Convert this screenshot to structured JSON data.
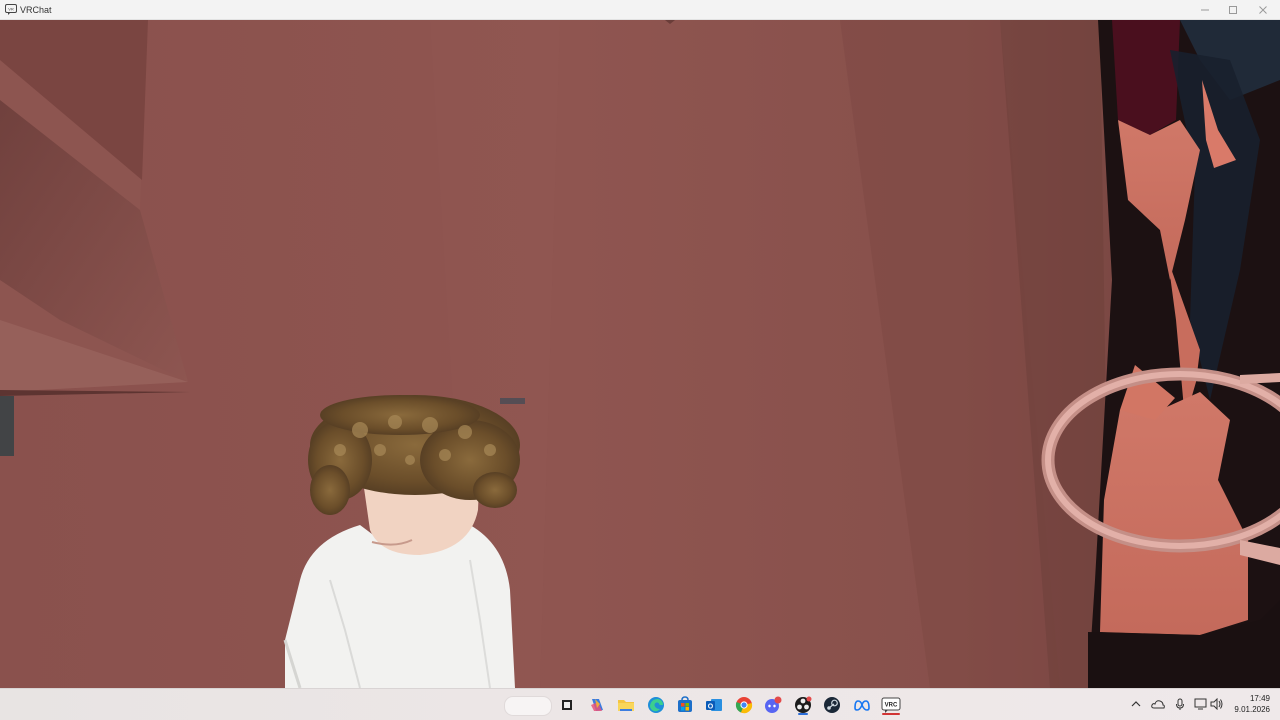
{
  "window": {
    "title": "VRChat",
    "icon": "vrchat-app-icon",
    "controls": [
      "minimize-icon",
      "maximize-icon",
      "close-icon"
    ]
  },
  "scene": {
    "description_colors": {
      "wall": "#8c524e",
      "wall_light": "#945a55",
      "wall_dark": "#6e3e3b",
      "skin": "#c97060",
      "dark": "#1a0f10",
      "hoop": "#d8a39b"
    }
  },
  "taskbar": {
    "pinned": [
      {
        "name": "search",
        "icon": "search-box"
      },
      {
        "name": "task-view",
        "icon": "task-view-icon"
      },
      {
        "name": "copilot",
        "icon": "copilot-icon"
      },
      {
        "name": "file-explorer",
        "icon": "folder-icon"
      },
      {
        "name": "edge",
        "icon": "edge-icon"
      },
      {
        "name": "store",
        "icon": "store-icon"
      },
      {
        "name": "outlook",
        "icon": "outlook-icon"
      },
      {
        "name": "chrome",
        "icon": "chrome-icon"
      },
      {
        "name": "discord",
        "icon": "discord-icon",
        "badge": "1"
      },
      {
        "name": "obs",
        "icon": "obs-icon"
      },
      {
        "name": "steam",
        "icon": "steam-icon"
      },
      {
        "name": "meta",
        "icon": "meta-icon"
      },
      {
        "name": "vrchat",
        "icon": "vrchat-icon",
        "label": "VRC",
        "active": true
      }
    ],
    "tray": [
      "chevron-up-icon",
      "onedrive-icon",
      "microphone-icon",
      "network-icon",
      "volume-icon"
    ],
    "clock": {
      "time": "17:49",
      "date": "9.01.2026"
    }
  }
}
